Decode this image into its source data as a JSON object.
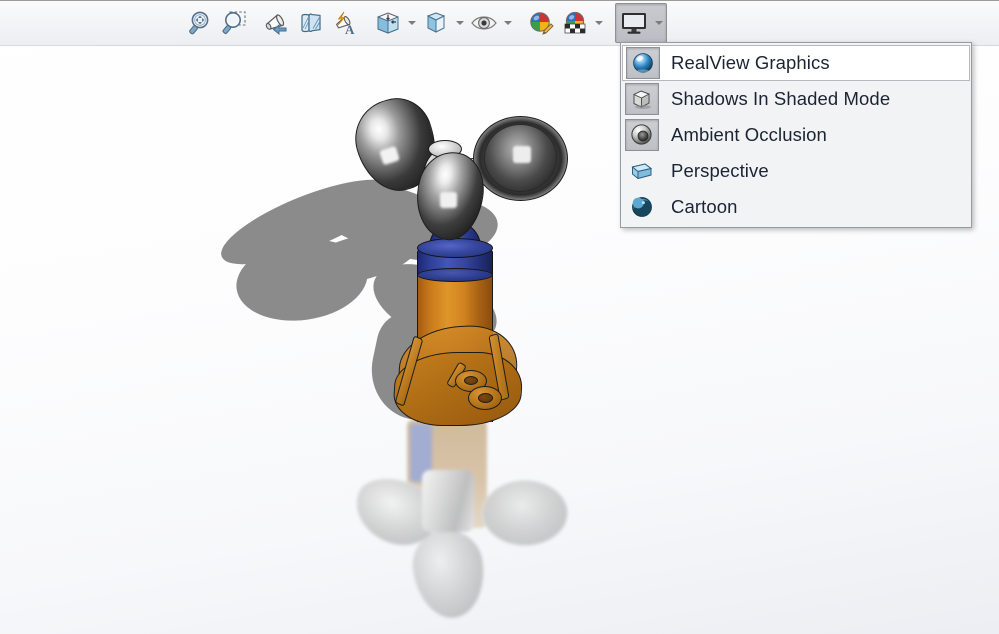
{
  "app": {
    "title": "SolidWorks 3D Viewport",
    "background_top": "#ffffff",
    "background_bottom": "#eceef3"
  },
  "toolbar": {
    "name": "view-heads-up-toolbar",
    "buttons": [
      {
        "id": "zoom-to-fit",
        "icon": "zoom-to-fit-icon",
        "label": "Zoom to Fit",
        "pressed": false,
        "has_caret": false
      },
      {
        "id": "zoom-to-area",
        "icon": "zoom-to-area-icon",
        "label": "Zoom to Area",
        "pressed": false,
        "has_caret": false
      },
      {
        "id": "previous-view",
        "icon": "previous-view-icon",
        "label": "Previous View",
        "pressed": false,
        "has_caret": false
      },
      {
        "id": "section-view",
        "icon": "section-view-icon",
        "label": "Section View",
        "pressed": false,
        "has_caret": false
      },
      {
        "id": "view-orientation",
        "icon": "view-orientation-icon",
        "label": "View Orientation",
        "pressed": false,
        "has_caret": false
      },
      {
        "id": "display-style",
        "icon": "display-style-icon",
        "label": "Display Style",
        "pressed": false,
        "has_caret": true
      },
      {
        "id": "hide-show-items",
        "icon": "hide-show-items-icon",
        "label": "Hide/Show Items",
        "pressed": false,
        "has_caret": true
      },
      {
        "id": "edit-appearance",
        "icon": "edit-appearance-icon",
        "label": "Edit Appearance",
        "pressed": false,
        "has_caret": false
      },
      {
        "id": "apply-scene",
        "icon": "apply-scene-icon",
        "label": "Apply Scene",
        "pressed": false,
        "has_caret": true
      },
      {
        "id": "view-settings",
        "icon": "view-settings-monitor-icon",
        "label": "View Settings",
        "pressed": true,
        "has_caret": true
      }
    ]
  },
  "menu": {
    "name": "view-settings-menu",
    "open": true,
    "items": [
      {
        "label": "RealView Graphics",
        "icon": "realview-sphere-icon",
        "toggled": true,
        "hovered": true
      },
      {
        "label": "Shadows In Shaded Mode",
        "icon": "shadow-cube-icon",
        "toggled": true,
        "hovered": false
      },
      {
        "label": "Ambient Occlusion",
        "icon": "ambient-occlusion-icon",
        "toggled": true,
        "hovered": false
      },
      {
        "label": "Perspective",
        "icon": "perspective-wedge-icon",
        "toggled": false,
        "hovered": false
      },
      {
        "label": "Cartoon",
        "icon": "cartoon-sphere-icon",
        "toggled": false,
        "hovered": false
      }
    ]
  },
  "viewport": {
    "name": "graphics-viewport",
    "model_name": "anemometer-assembly",
    "shadow_color": "#8b8b8b",
    "part_colors": {
      "body_orange": "#c87a1b",
      "body_blue": "#36479f",
      "cups_chrome": "#8a8a8a"
    }
  }
}
